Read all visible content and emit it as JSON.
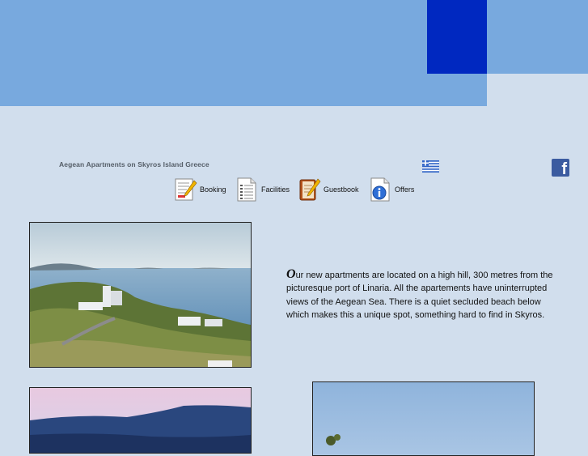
{
  "site": {
    "title": "Aegean Apartments on Skyros Island Greece"
  },
  "nav": [
    {
      "label": "Booking",
      "icon": "booking-form-pencil-icon"
    },
    {
      "label": "Facilities",
      "icon": "facilities-list-document-icon"
    },
    {
      "label": "Guestbook",
      "icon": "guestbook-notebook-pencil-icon"
    },
    {
      "label": "Offers",
      "icon": "offers-info-document-icon"
    }
  ],
  "language": {
    "flag": "greek-flag-icon"
  },
  "social": {
    "facebook_letter": "f",
    "icon": "facebook-icon"
  },
  "intro": {
    "initial": "O",
    "text": "ur new apartments are located on a high hill, 300 metres from the picturesque port of Linaria. All the apartements have uninterrupted views of the Aegean Sea. There is a quiet secluded beach below which makes this a unique spot, something hard to find in Skyros."
  },
  "colors": {
    "background": "#d1deed",
    "banner": "#78a9de",
    "banner_accent": "#0028c0"
  }
}
